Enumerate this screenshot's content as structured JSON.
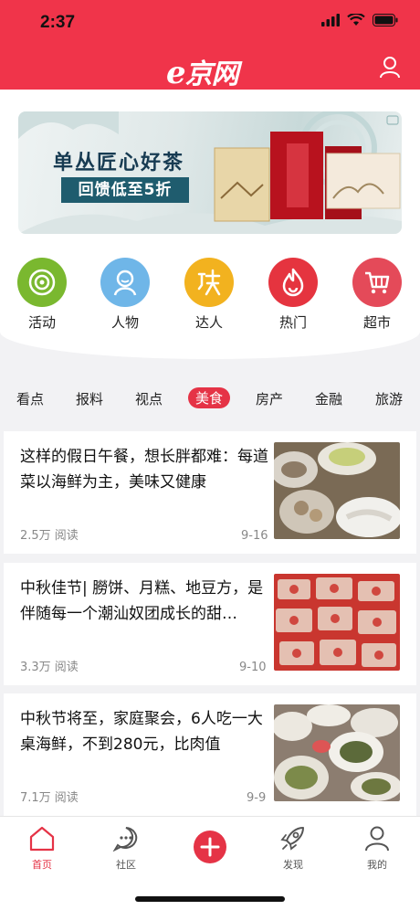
{
  "status": {
    "time": "2:37"
  },
  "header": {
    "logo_e": "e",
    "logo_text": "京网"
  },
  "banner": {
    "title": "单丛匠心好茶",
    "subtitle": "回馈低至5折"
  },
  "shortcuts": [
    {
      "label": "活动",
      "icon": "target-icon",
      "color": "#7ab82f"
    },
    {
      "label": "人物",
      "icon": "person-icon",
      "color": "#6fb6e8"
    },
    {
      "label": "达人",
      "icon": "expert-icon",
      "color": "#f2b21f"
    },
    {
      "label": "热门",
      "icon": "flame-icon",
      "color": "#e5343f"
    },
    {
      "label": "超市",
      "icon": "cart-icon",
      "color": "#e44a59"
    }
  ],
  "tabs": [
    "看点",
    "报料",
    "视点",
    "美食",
    "房产",
    "金融",
    "旅游"
  ],
  "active_tab": "美食",
  "articles": [
    {
      "title": "这样的假日午餐，想长胖都难：每道菜以海鲜为主，美味又健康",
      "reads": "2.5万 阅读",
      "date": "9-16"
    },
    {
      "title": "中秋佳节| 朥饼、月糕、地豆方，是伴随每一个潮汕奴团成长的甜…",
      "reads": "3.3万 阅读",
      "date": "9-10"
    },
    {
      "title": "中秋节将至，家庭聚会，6人吃一大桌海鲜，不到280元，比肉值",
      "reads": "7.1万 阅读",
      "date": "9-9"
    }
  ],
  "bottom_nav": [
    {
      "label": "首页",
      "icon": "home-icon"
    },
    {
      "label": "社区",
      "icon": "chat-icon"
    },
    {
      "label": "",
      "icon": "plus-icon"
    },
    {
      "label": "发现",
      "icon": "rocket-icon"
    },
    {
      "label": "我的",
      "icon": "user-icon"
    }
  ],
  "accent_color": "#f0344a"
}
